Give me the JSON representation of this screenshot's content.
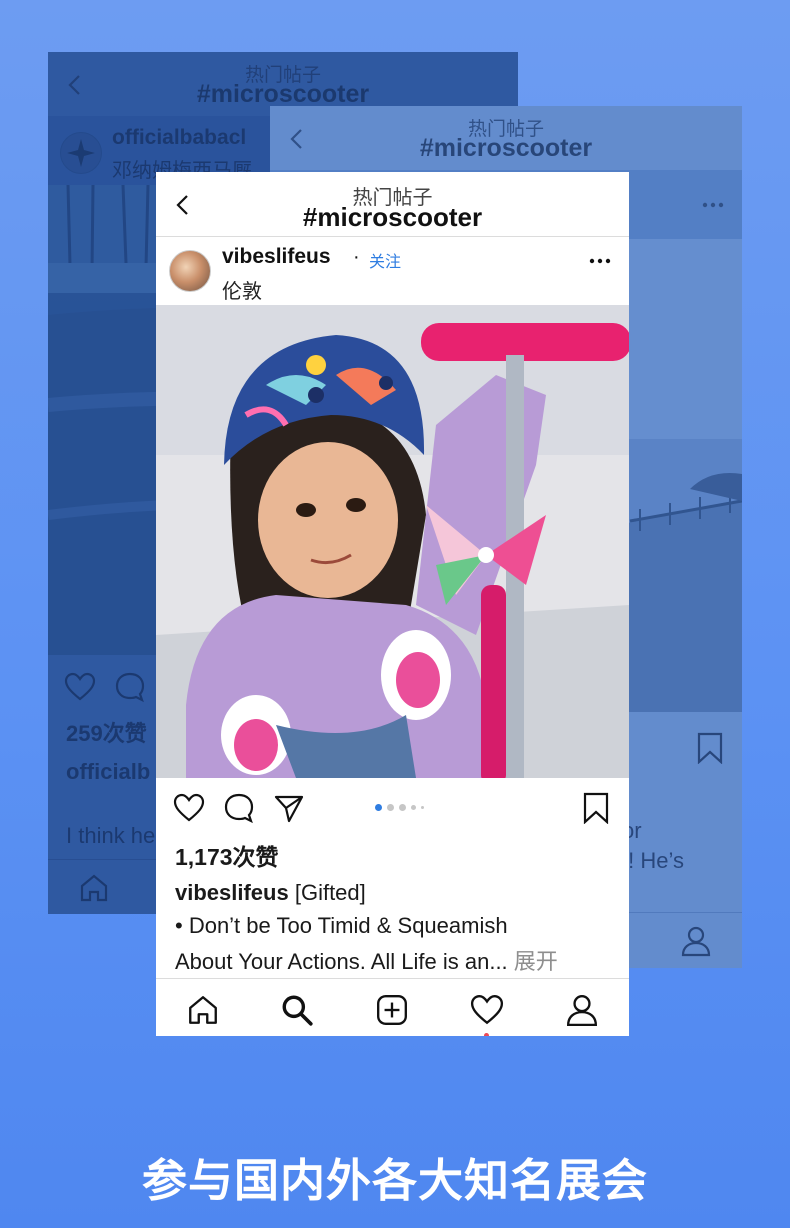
{
  "back_card_1": {
    "header_small": "热门帖子",
    "header_hashtag": "#microscooter",
    "username": "officialbabacl",
    "location": "邓纳姆梅西马厩",
    "likes": "259次赞",
    "caption_user": "officialb",
    "comment": "I think he"
  },
  "back_card_2": {
    "header_small": "热门帖子",
    "header_hashtag": "#microscooter",
    "caption_fragment_1": "or",
    "caption_fragment_2": "!! He’s"
  },
  "post": {
    "header_small": "热门帖子",
    "header_hashtag": "#microscooter",
    "username": "vibeslifeus",
    "dot": "·",
    "follow": "关注",
    "location": "伦敦",
    "likes": "1,173次赞",
    "caption_user": "vibeslifeus",
    "caption_tag": "[Gifted]",
    "caption_line2": "• Don’t be Too Timid & Squeamish",
    "caption_line3": "About Your Actions.  All Life is an...",
    "more_label": "展开",
    "page_index": 1,
    "page_count": 5
  },
  "banner": {
    "title": "参与国内外各大知名展会"
  },
  "icons": [
    "back-chevron-icon",
    "more-icon",
    "heart-icon",
    "comment-icon",
    "share-icon",
    "bookmark-icon",
    "home-icon",
    "search-icon",
    "add-icon",
    "activity-icon",
    "profile-icon"
  ],
  "colors": {
    "background": "#5b91f3",
    "follow_link": "#2f7de1",
    "active_dot": "#2f7de1",
    "notification": "#ed4956",
    "helmet": "#2b4d9b",
    "scooter": "#e8226f"
  }
}
